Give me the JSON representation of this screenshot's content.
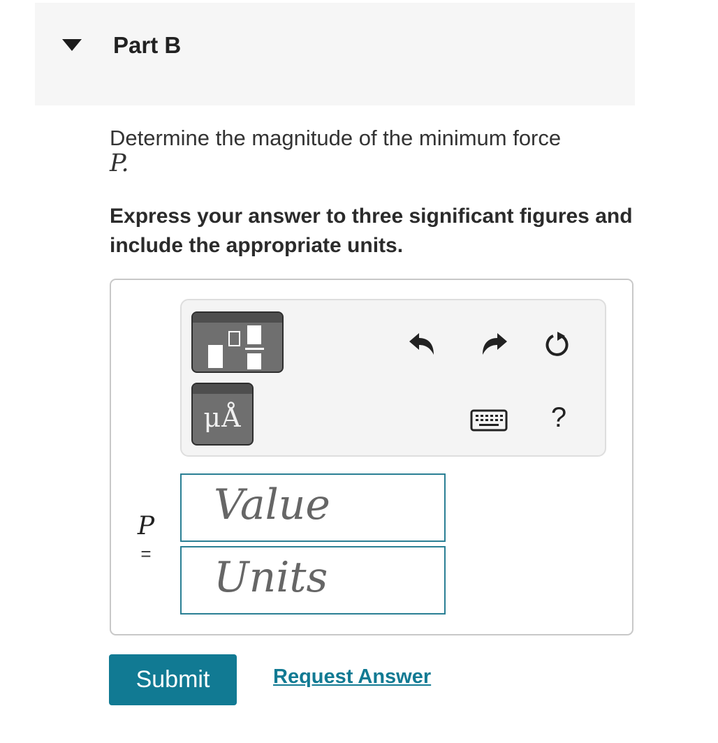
{
  "part": {
    "title": "Part B"
  },
  "question": {
    "text": "Determine the magnitude of the minimum force",
    "variable": "P."
  },
  "instructions": "Express your answer to three significant figures and include the appropriate units.",
  "toolbar": {
    "templates_icon": "fraction-exponent-templates-icon",
    "units_symbol": "μÅ",
    "undo_icon": "undo-icon",
    "redo_icon": "redo-icon",
    "reset_icon": "reset-icon",
    "keyboard_icon": "keyboard-icon",
    "help_label": "?"
  },
  "answer": {
    "variable": "P",
    "equals": "=",
    "value_placeholder": "Value",
    "units_placeholder": "Units"
  },
  "actions": {
    "submit_label": "Submit",
    "request_answer_label": "Request Answer"
  },
  "colors": {
    "accent": "#117a93",
    "field_border": "#2a7f94",
    "header_bg": "#f6f6f6",
    "tool_button": "#6f6f6f"
  }
}
